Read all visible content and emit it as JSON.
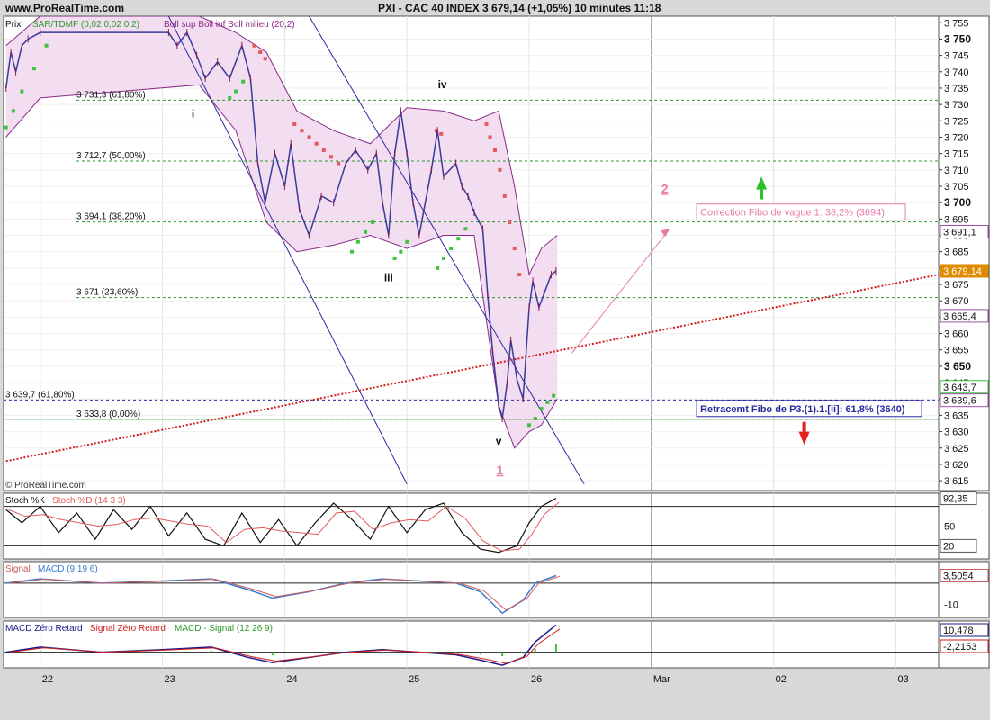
{
  "header": {
    "site": "www.ProRealTime.com",
    "title": "PXI - CAC 40 INDEX     3 679,14  (+1,05%)     10 minutes  11:18"
  },
  "chart_data": {
    "type": "line",
    "instrument": "PXI - CAC 40 INDEX",
    "last_price": "3 679,14",
    "change": "(+1,05%)",
    "timeframe": "10 minutes",
    "time": "11:18",
    "watermark": "© ProRealTime.com",
    "price_panel": {
      "legend": [
        "Prix",
        "SAR/TDMF (0,02 0,02 0,2)",
        "Boll sup",
        "Boll inf",
        "Boll milieu (20,2)"
      ],
      "ylim": [
        3612,
        3757
      ],
      "y_ticks": [
        3615,
        3620,
        3625,
        3630,
        3635,
        3640,
        3645,
        3650,
        3655,
        3660,
        3665,
        3670,
        3675,
        3680,
        3685,
        3690,
        3695,
        3700,
        3705,
        3710,
        3715,
        3720,
        3725,
        3730,
        3735,
        3740,
        3745,
        3750,
        3755
      ],
      "y_tick_labels": [
        "3 615",
        "3 620",
        "3 625",
        "3 630",
        "3 635",
        "3 640",
        "3 645",
        "3 650",
        "3 655",
        "3 660",
        "3 665",
        "3 670",
        "3 675",
        "3 680",
        "3 685",
        "3 690",
        "3 695",
        "3 700",
        "3 705",
        "3 710",
        "3 715",
        "3 720",
        "3 725",
        "3 730",
        "3 735",
        "3 740",
        "3 745",
        "3 750",
        "3 755"
      ],
      "bold_ticks": [
        3650,
        3700,
        3750
      ],
      "x_ticks": [
        22,
        23,
        24,
        25,
        26,
        27,
        28,
        29
      ],
      "x_tick_labels": [
        "22",
        "23",
        "24",
        "25",
        "26",
        "Mar",
        "02",
        "03"
      ],
      "xlim": [
        21.7,
        29.35
      ],
      "price_series": [
        {
          "x": 21.72,
          "y": 3735
        },
        {
          "x": 21.76,
          "y": 3746
        },
        {
          "x": 21.8,
          "y": 3740
        },
        {
          "x": 21.85,
          "y": 3748
        },
        {
          "x": 21.9,
          "y": 3750
        },
        {
          "x": 22.0,
          "y": 3752
        },
        {
          "x": 23.05,
          "y": 3752
        },
        {
          "x": 23.12,
          "y": 3748
        },
        {
          "x": 23.2,
          "y": 3752
        },
        {
          "x": 23.28,
          "y": 3745
        },
        {
          "x": 23.35,
          "y": 3738
        },
        {
          "x": 23.45,
          "y": 3743
        },
        {
          "x": 23.55,
          "y": 3738
        },
        {
          "x": 23.65,
          "y": 3748
        },
        {
          "x": 23.72,
          "y": 3738
        },
        {
          "x": 23.78,
          "y": 3712
        },
        {
          "x": 23.84,
          "y": 3700
        },
        {
          "x": 23.92,
          "y": 3715
        },
        {
          "x": 24.0,
          "y": 3705
        },
        {
          "x": 24.05,
          "y": 3718
        },
        {
          "x": 24.12,
          "y": 3698
        },
        {
          "x": 24.2,
          "y": 3690
        },
        {
          "x": 24.3,
          "y": 3702
        },
        {
          "x": 24.4,
          "y": 3700
        },
        {
          "x": 24.5,
          "y": 3712
        },
        {
          "x": 24.58,
          "y": 3716
        },
        {
          "x": 24.68,
          "y": 3710
        },
        {
          "x": 24.75,
          "y": 3715
        },
        {
          "x": 24.8,
          "y": 3700
        },
        {
          "x": 24.85,
          "y": 3690
        },
        {
          "x": 24.9,
          "y": 3715
        },
        {
          "x": 24.95,
          "y": 3728
        },
        {
          "x": 25.0,
          "y": 3715
        },
        {
          "x": 25.05,
          "y": 3700
        },
        {
          "x": 25.1,
          "y": 3690
        },
        {
          "x": 25.2,
          "y": 3710
        },
        {
          "x": 25.25,
          "y": 3722
        },
        {
          "x": 25.3,
          "y": 3708
        },
        {
          "x": 25.4,
          "y": 3712
        },
        {
          "x": 25.45,
          "y": 3705
        },
        {
          "x": 25.5,
          "y": 3702
        },
        {
          "x": 25.55,
          "y": 3697
        },
        {
          "x": 25.62,
          "y": 3692
        },
        {
          "x": 25.66,
          "y": 3672
        },
        {
          "x": 25.7,
          "y": 3655
        },
        {
          "x": 25.75,
          "y": 3638
        },
        {
          "x": 25.78,
          "y": 3634
        },
        {
          "x": 25.82,
          "y": 3645
        },
        {
          "x": 25.85,
          "y": 3658
        },
        {
          "x": 25.9,
          "y": 3646
        },
        {
          "x": 25.95,
          "y": 3640
        },
        {
          "x": 26.0,
          "y": 3668
        },
        {
          "x": 26.03,
          "y": 3676
        },
        {
          "x": 26.08,
          "y": 3668
        },
        {
          "x": 26.12,
          "y": 3672
        },
        {
          "x": 26.18,
          "y": 3678
        },
        {
          "x": 26.22,
          "y": 3679.14
        }
      ],
      "bollinger_upper": [
        {
          "x": 21.72,
          "y": 3748
        },
        {
          "x": 22.0,
          "y": 3757
        },
        {
          "x": 23.3,
          "y": 3757
        },
        {
          "x": 23.6,
          "y": 3752
        },
        {
          "x": 23.85,
          "y": 3746
        },
        {
          "x": 24.1,
          "y": 3728
        },
        {
          "x": 24.4,
          "y": 3722
        },
        {
          "x": 24.7,
          "y": 3718
        },
        {
          "x": 25.0,
          "y": 3729
        },
        {
          "x": 25.3,
          "y": 3728
        },
        {
          "x": 25.55,
          "y": 3725
        },
        {
          "x": 25.75,
          "y": 3728
        },
        {
          "x": 25.88,
          "y": 3705
        },
        {
          "x": 26.0,
          "y": 3678
        },
        {
          "x": 26.1,
          "y": 3686
        },
        {
          "x": 26.23,
          "y": 3690
        }
      ],
      "bollinger_lower": [
        {
          "x": 21.72,
          "y": 3720
        },
        {
          "x": 22.0,
          "y": 3732
        },
        {
          "x": 23.3,
          "y": 3736
        },
        {
          "x": 23.6,
          "y": 3722
        },
        {
          "x": 23.85,
          "y": 3694
        },
        {
          "x": 24.1,
          "y": 3685
        },
        {
          "x": 24.4,
          "y": 3687
        },
        {
          "x": 24.7,
          "y": 3690
        },
        {
          "x": 25.0,
          "y": 3686
        },
        {
          "x": 25.3,
          "y": 3690
        },
        {
          "x": 25.55,
          "y": 3690
        },
        {
          "x": 25.75,
          "y": 3638
        },
        {
          "x": 25.88,
          "y": 3625
        },
        {
          "x": 26.0,
          "y": 3630
        },
        {
          "x": 26.1,
          "y": 3632
        },
        {
          "x": 26.23,
          "y": 3640
        }
      ],
      "sar_down": [
        {
          "x": 23.75,
          "y": 3748
        },
        {
          "x": 23.8,
          "y": 3746
        },
        {
          "x": 23.84,
          "y": 3744
        },
        {
          "x": 24.08,
          "y": 3724
        },
        {
          "x": 24.14,
          "y": 3722
        },
        {
          "x": 24.2,
          "y": 3720
        },
        {
          "x": 24.26,
          "y": 3718
        },
        {
          "x": 24.32,
          "y": 3716
        },
        {
          "x": 24.38,
          "y": 3714
        },
        {
          "x": 24.44,
          "y": 3712
        },
        {
          "x": 25.24,
          "y": 3722
        },
        {
          "x": 25.28,
          "y": 3721
        },
        {
          "x": 25.65,
          "y": 3724
        },
        {
          "x": 25.68,
          "y": 3720
        },
        {
          "x": 25.72,
          "y": 3716
        },
        {
          "x": 25.76,
          "y": 3710
        },
        {
          "x": 25.8,
          "y": 3702
        },
        {
          "x": 25.84,
          "y": 3694
        },
        {
          "x": 25.88,
          "y": 3686
        },
        {
          "x": 25.92,
          "y": 3678
        }
      ],
      "sar_up": [
        {
          "x": 21.72,
          "y": 3723
        },
        {
          "x": 21.78,
          "y": 3728
        },
        {
          "x": 21.85,
          "y": 3734
        },
        {
          "x": 21.95,
          "y": 3741
        },
        {
          "x": 22.05,
          "y": 3748
        },
        {
          "x": 23.55,
          "y": 3732
        },
        {
          "x": 23.6,
          "y": 3734
        },
        {
          "x": 23.66,
          "y": 3737
        },
        {
          "x": 24.55,
          "y": 3685
        },
        {
          "x": 24.6,
          "y": 3688
        },
        {
          "x": 24.66,
          "y": 3691
        },
        {
          "x": 24.72,
          "y": 3694
        },
        {
          "x": 24.9,
          "y": 3683
        },
        {
          "x": 24.95,
          "y": 3685
        },
        {
          "x": 25.0,
          "y": 3688
        },
        {
          "x": 25.25,
          "y": 3680
        },
        {
          "x": 25.3,
          "y": 3683
        },
        {
          "x": 25.36,
          "y": 3686
        },
        {
          "x": 25.42,
          "y": 3689
        },
        {
          "x": 25.48,
          "y": 3692
        },
        {
          "x": 26.0,
          "y": 3632
        },
        {
          "x": 26.05,
          "y": 3634
        },
        {
          "x": 26.1,
          "y": 3637
        },
        {
          "x": 26.15,
          "y": 3639
        },
        {
          "x": 26.2,
          "y": 3641
        }
      ],
      "fibo_levels": [
        {
          "label": "3 731,3 (61,80%)",
          "y": 3731.3
        },
        {
          "label": "3 712,7 (50,00%)",
          "y": 3712.7
        },
        {
          "label": "3 694,1 (38,20%)",
          "y": 3694.1
        },
        {
          "label": "3 671 (23,60%)",
          "y": 3671
        },
        {
          "label": "3 633,8 (0,00%)",
          "y": 3633.8
        }
      ],
      "fibo_extra": {
        "label": "3 639,7 (61,80%)",
        "y": 3639.7
      },
      "channel_lines": [
        {
          "x1": 23.05,
          "y1": 3757,
          "x2": 25.0,
          "y2": 3614
        },
        {
          "x1": 24.2,
          "y1": 3757,
          "x2": 26.45,
          "y2": 3614
        }
      ],
      "trend_line": {
        "x1": 21.72,
        "y1": 3621,
        "x2": 29.35,
        "y2": 3678
      },
      "projection_arrow": {
        "x1": 26.35,
        "y1": 3654,
        "x2": 27.15,
        "y2": 3692
      },
      "wave_labels": [
        {
          "text": "i",
          "x": 23.25,
          "y": 3726
        },
        {
          "text": "iv",
          "x": 25.29,
          "y": 3735
        },
        {
          "text": "iii",
          "x": 24.85,
          "y": 3676
        },
        {
          "text": "v",
          "x": 25.75,
          "y": 3626
        },
        {
          "text": "2",
          "x": 27.11,
          "y": 3703
        },
        {
          "text": "1",
          "x": 25.76,
          "y": 3617
        }
      ],
      "annotations": [
        {
          "text": "Correction Fibo de vague 1: 38,2% (3694)",
          "x": 27.37,
          "y": 3696,
          "color": "#e87aa8"
        },
        {
          "text": "Retracemt Fibo de P3.(1).1.[ii]: 61,8% (3640)",
          "x": 27.37,
          "y": 3636,
          "color": "#2a2aa0"
        }
      ],
      "price_tags": [
        {
          "label": "3 691,1",
          "y": 3691.1,
          "color": "#9b4fa6"
        },
        {
          "label": "3 679,14",
          "y": 3679.14,
          "color": "#e08a00"
        },
        {
          "label": "3 665,4",
          "y": 3665.4,
          "color": "#9b4fa6"
        },
        {
          "label": "3 643,7",
          "y": 3643.7,
          "color": "#35c235"
        },
        {
          "label": "3 639,6",
          "y": 3639.6,
          "color": "#9b4fa6"
        }
      ]
    },
    "stoch_panel": {
      "legend": [
        "Stoch %K",
        "Stoch %D (14 3 3)"
      ],
      "ylim": [
        0,
        100
      ],
      "y_ticks": [
        50
      ],
      "levels": [
        80,
        20
      ],
      "tags": [
        {
          "label": "92,35",
          "y": 92.35
        },
        {
          "label": "20",
          "y": 20
        }
      ],
      "k_series": [
        {
          "x": 21.72,
          "y": 75
        },
        {
          "x": 21.85,
          "y": 55
        },
        {
          "x": 22.0,
          "y": 80
        },
        {
          "x": 22.15,
          "y": 40
        },
        {
          "x": 22.3,
          "y": 70
        },
        {
          "x": 22.45,
          "y": 30
        },
        {
          "x": 22.6,
          "y": 75
        },
        {
          "x": 22.75,
          "y": 45
        },
        {
          "x": 22.9,
          "y": 80
        },
        {
          "x": 23.05,
          "y": 35
        },
        {
          "x": 23.2,
          "y": 70
        },
        {
          "x": 23.35,
          "y": 30
        },
        {
          "x": 23.5,
          "y": 20
        },
        {
          "x": 23.65,
          "y": 70
        },
        {
          "x": 23.8,
          "y": 25
        },
        {
          "x": 23.95,
          "y": 60
        },
        {
          "x": 24.1,
          "y": 20
        },
        {
          "x": 24.25,
          "y": 55
        },
        {
          "x": 24.4,
          "y": 85
        },
        {
          "x": 24.55,
          "y": 60
        },
        {
          "x": 24.7,
          "y": 30
        },
        {
          "x": 24.85,
          "y": 80
        },
        {
          "x": 25.0,
          "y": 40
        },
        {
          "x": 25.15,
          "y": 75
        },
        {
          "x": 25.3,
          "y": 85
        },
        {
          "x": 25.45,
          "y": 40
        },
        {
          "x": 25.6,
          "y": 15
        },
        {
          "x": 25.75,
          "y": 10
        },
        {
          "x": 25.9,
          "y": 20
        },
        {
          "x": 26.0,
          "y": 55
        },
        {
          "x": 26.1,
          "y": 80
        },
        {
          "x": 26.22,
          "y": 92.35
        }
      ]
    },
    "macd_panel": {
      "legend": [
        "Signal",
        "MACD (9 19 6)"
      ],
      "y_ticks": [
        -10
      ],
      "ylim": [
        -16,
        10
      ],
      "tags": [
        {
          "label": "3,5054",
          "y": 3.5054
        }
      ],
      "series": [
        {
          "x": 21.72,
          "y": 0
        },
        {
          "x": 22.0,
          "y": 2
        },
        {
          "x": 22.5,
          "y": 0
        },
        {
          "x": 23.0,
          "y": 1
        },
        {
          "x": 23.4,
          "y": 2
        },
        {
          "x": 23.7,
          "y": -3
        },
        {
          "x": 23.9,
          "y": -7
        },
        {
          "x": 24.2,
          "y": -4
        },
        {
          "x": 24.5,
          "y": 0
        },
        {
          "x": 24.8,
          "y": 2
        },
        {
          "x": 25.1,
          "y": 1
        },
        {
          "x": 25.4,
          "y": 0
        },
        {
          "x": 25.6,
          "y": -4
        },
        {
          "x": 25.78,
          "y": -14
        },
        {
          "x": 25.95,
          "y": -8
        },
        {
          "x": 26.05,
          "y": 0
        },
        {
          "x": 26.22,
          "y": 3.5
        }
      ]
    },
    "macd_zero_panel": {
      "legend": [
        "MACD Zéro Retard",
        "Signal Zéro Retard",
        "MACD - Signal (12 26 9)"
      ],
      "ylim": [
        -6,
        12
      ],
      "tags": [
        {
          "label": "10,478",
          "y": 10.478
        },
        {
          "label": "-2,2153",
          "y": -2.2153
        }
      ],
      "series": [
        {
          "x": 21.72,
          "y": 0
        },
        {
          "x": 22.0,
          "y": 2
        },
        {
          "x": 22.5,
          "y": 0
        },
        {
          "x": 23.0,
          "y": 1
        },
        {
          "x": 23.4,
          "y": 2
        },
        {
          "x": 23.7,
          "y": -2
        },
        {
          "x": 23.9,
          "y": -4
        },
        {
          "x": 24.2,
          "y": -2
        },
        {
          "x": 24.5,
          "y": 0
        },
        {
          "x": 24.8,
          "y": 1
        },
        {
          "x": 25.1,
          "y": 0
        },
        {
          "x": 25.4,
          "y": -1
        },
        {
          "x": 25.6,
          "y": -3
        },
        {
          "x": 25.78,
          "y": -5
        },
        {
          "x": 25.95,
          "y": -2
        },
        {
          "x": 26.05,
          "y": 4
        },
        {
          "x": 26.22,
          "y": 10.5
        }
      ]
    },
    "colors": {
      "price": "#3a3a9a",
      "bollinger_fill": "#f2d9ee",
      "bollinger_line": "#8a2a8a",
      "sar_down": "#e35a5a",
      "sar_up": "#3fc23f",
      "fibo": "#2a9a2a",
      "trend": "#d11a1a",
      "channel": "#2a2aa0",
      "arrow": "#e87aa8",
      "stoch_k": "#111111",
      "stoch_d": "#e35a5a",
      "macd": "#3a7ad0",
      "signal": "#d05a5a"
    }
  }
}
